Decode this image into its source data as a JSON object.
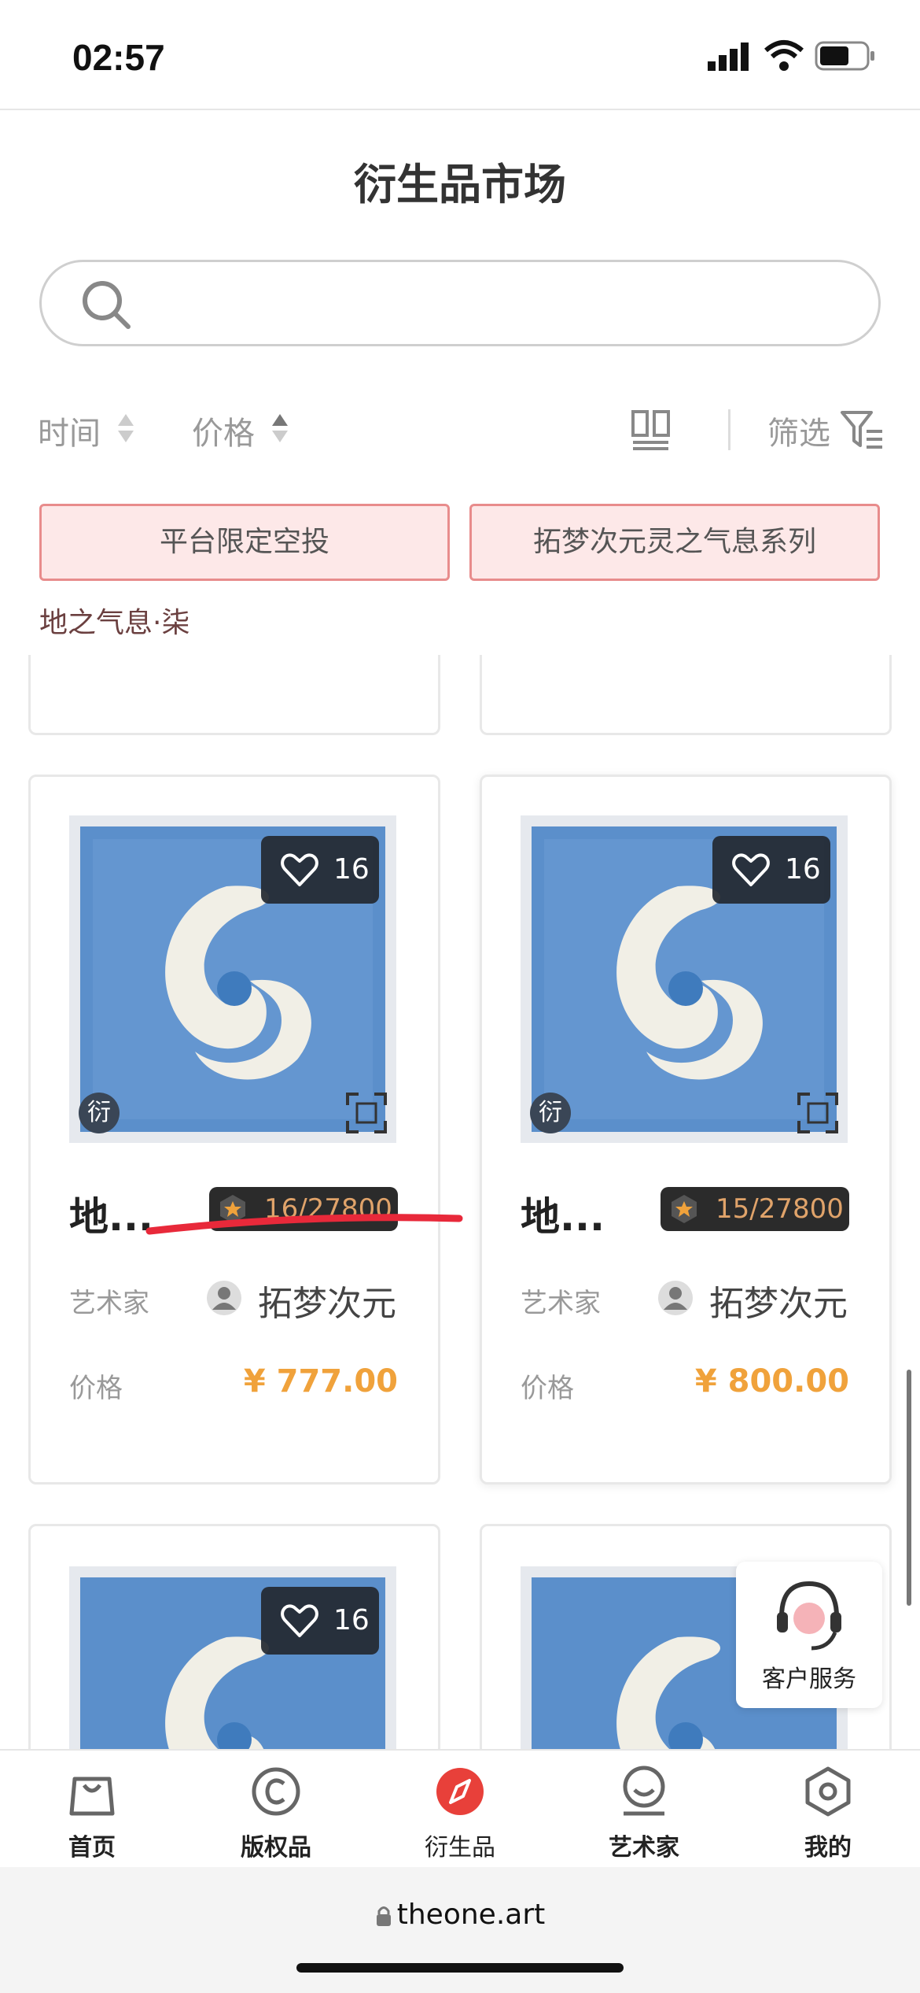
{
  "status_bar": {
    "time": "02:57"
  },
  "page_title": "衍生品市场",
  "search": {
    "placeholder": ""
  },
  "sort": {
    "time_label": "时间",
    "price_label": "价格",
    "filter_label": "筛选"
  },
  "top_tags": [
    "平台限定空投",
    "拓梦次元灵之气息系列"
  ],
  "top_item_name": "地之气息·柒",
  "cards": [
    {
      "likes": "16",
      "badge": "衍",
      "name": "地...",
      "edition": "16/27800",
      "artist_label": "艺术家",
      "artist": "拓梦次元",
      "price_label": "价格",
      "price": "¥ 777.00"
    },
    {
      "likes": "16",
      "badge": "衍",
      "name": "地...",
      "edition": "15/27800",
      "artist_label": "艺术家",
      "artist": "拓梦次元",
      "price_label": "价格",
      "price": "¥ 800.00"
    },
    {
      "likes": "16"
    }
  ],
  "customer_service": "客户服务",
  "nav": [
    {
      "label": "首页",
      "icon": "shopping-bag-icon"
    },
    {
      "label": "版权品",
      "icon": "copyright-icon"
    },
    {
      "label": "衍生品",
      "icon": "compass-icon"
    },
    {
      "label": "艺术家",
      "icon": "artist-icon"
    },
    {
      "label": "我的",
      "icon": "hexagon-icon"
    }
  ],
  "url": "theone.art",
  "colors": {
    "accent": "#f0a23b",
    "tag_bg": "#fde8e8",
    "tag_border": "#e88c8c",
    "nav_active": "#e8403a"
  }
}
